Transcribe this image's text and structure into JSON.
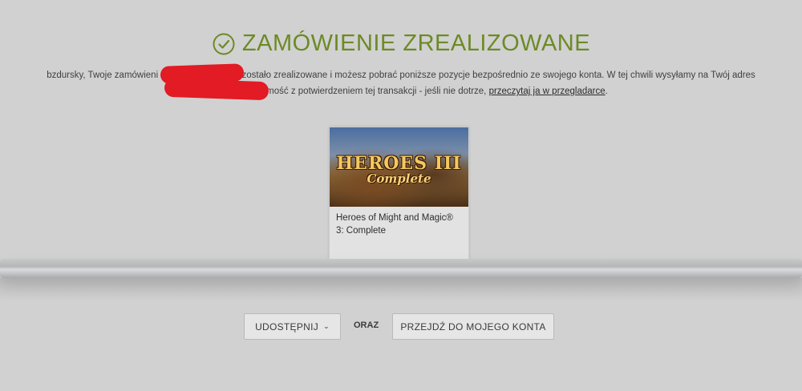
{
  "header": {
    "title": "ZAMÓWIENIE ZREALIZOWANE",
    "icon": "check-circle-icon",
    "accent_color": "#6d8a26"
  },
  "message": {
    "user": "bzdursky",
    "part1": ", Twoje zamówieni",
    "part2": "zostało zrealizowane i możesz pobrać poniższe pozycje bezpośrednio ze swojego konta. W tej chwili wysyłamy na Twój adres",
    "part3": "wiadomość z potwierdzeniem tej transakcji - jeśli nie dotrze,",
    "link": "przeczytaj ja w przegladarce",
    "end": "."
  },
  "product": {
    "name": "Heroes of Might and Magic® 3: Complete",
    "cover_line1": "HEROES III",
    "cover_line2": "Complete"
  },
  "actions": {
    "share_label": "UDOSTĘPNIJ",
    "or_label": "ORAZ",
    "account_label": "PRZEJDŹ DO MOJEGO KONTA"
  }
}
